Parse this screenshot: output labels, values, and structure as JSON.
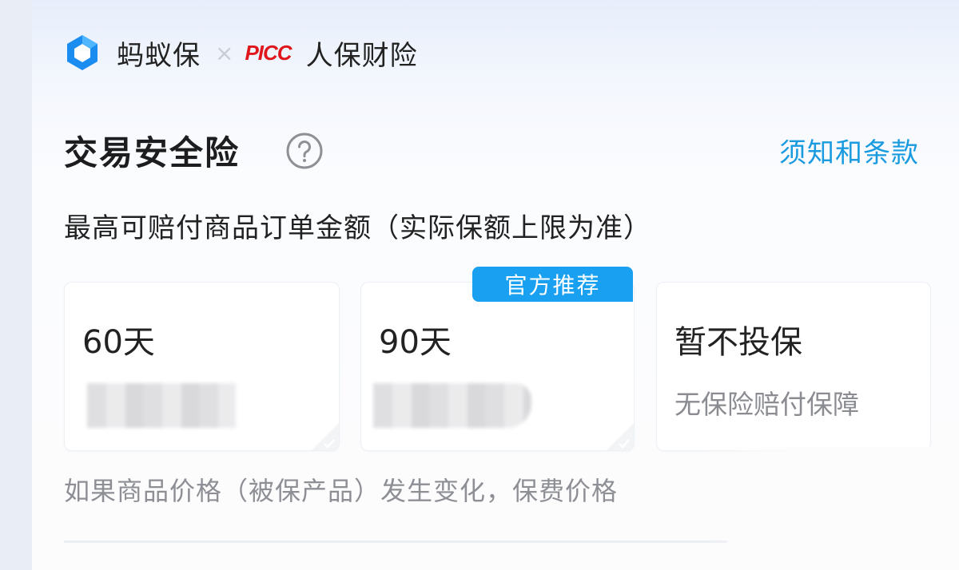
{
  "header": {
    "brand_name": "蚂蚁保",
    "times_symbol": "×",
    "partner_logo_text": "PICC",
    "partner_name": "人保财险"
  },
  "insurance": {
    "title": "交易安全险",
    "help_icon": "question-circle-icon",
    "terms_link": "须知和条款",
    "subtitle": "最高可赔付商品订单金额（实际保额上限为准）"
  },
  "options": [
    {
      "label": "60天",
      "price_hidden": true
    },
    {
      "label": "90天",
      "price_hidden": true,
      "badge": "官方推荐"
    },
    {
      "label": "暂不投保",
      "description": "无保险赔付保障"
    }
  ],
  "note": "如果商品价格（被保产品）发生变化，保费价格",
  "colors": {
    "accent": "#1a9be0",
    "badge_bg": "#1aa0f0",
    "picc_red": "#e0161d",
    "ant_logo": "#1b8cf0"
  }
}
